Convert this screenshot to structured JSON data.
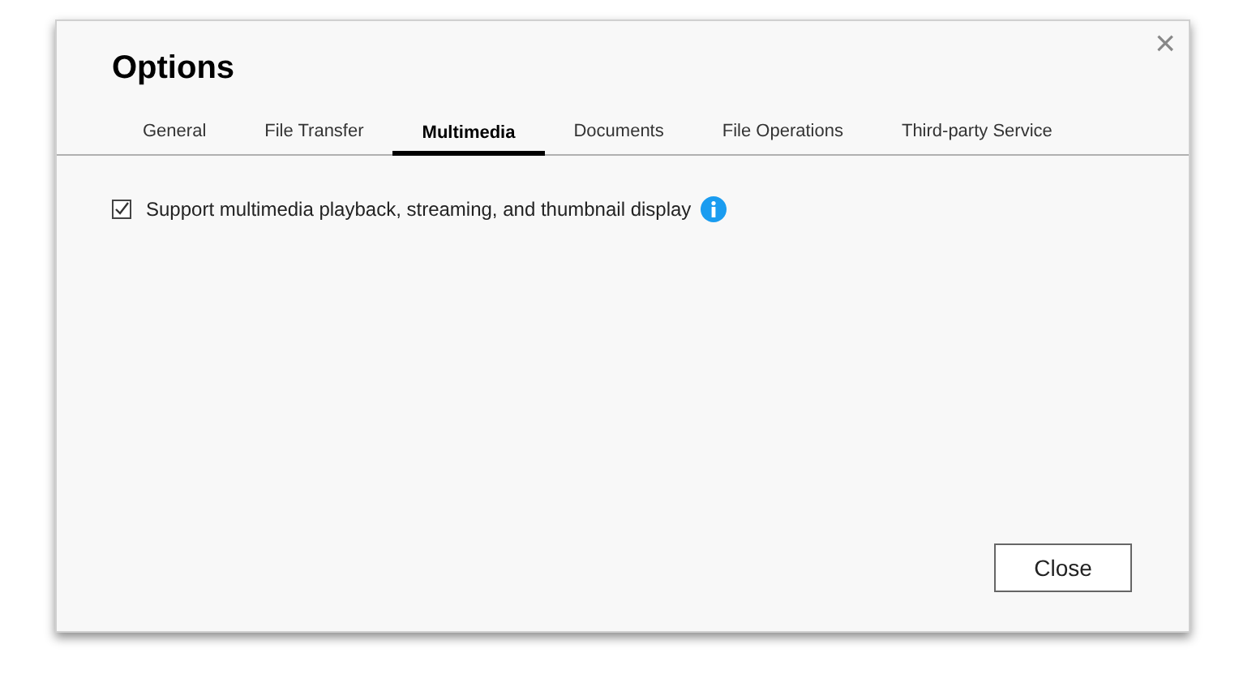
{
  "dialog": {
    "title": "Options",
    "close_icon": "×"
  },
  "tabs": [
    {
      "label": "General",
      "selected": false
    },
    {
      "label": "File Transfer",
      "selected": false
    },
    {
      "label": "Multimedia",
      "selected": true
    },
    {
      "label": "Documents",
      "selected": false
    },
    {
      "label": "File Operations",
      "selected": false
    },
    {
      "label": "Third-party Service",
      "selected": false
    }
  ],
  "options": [
    {
      "label": "Support multimedia playback, streaming, and thumbnail display",
      "checked": true,
      "info": true
    }
  ],
  "buttons": [
    {
      "label": "Close"
    }
  ]
}
